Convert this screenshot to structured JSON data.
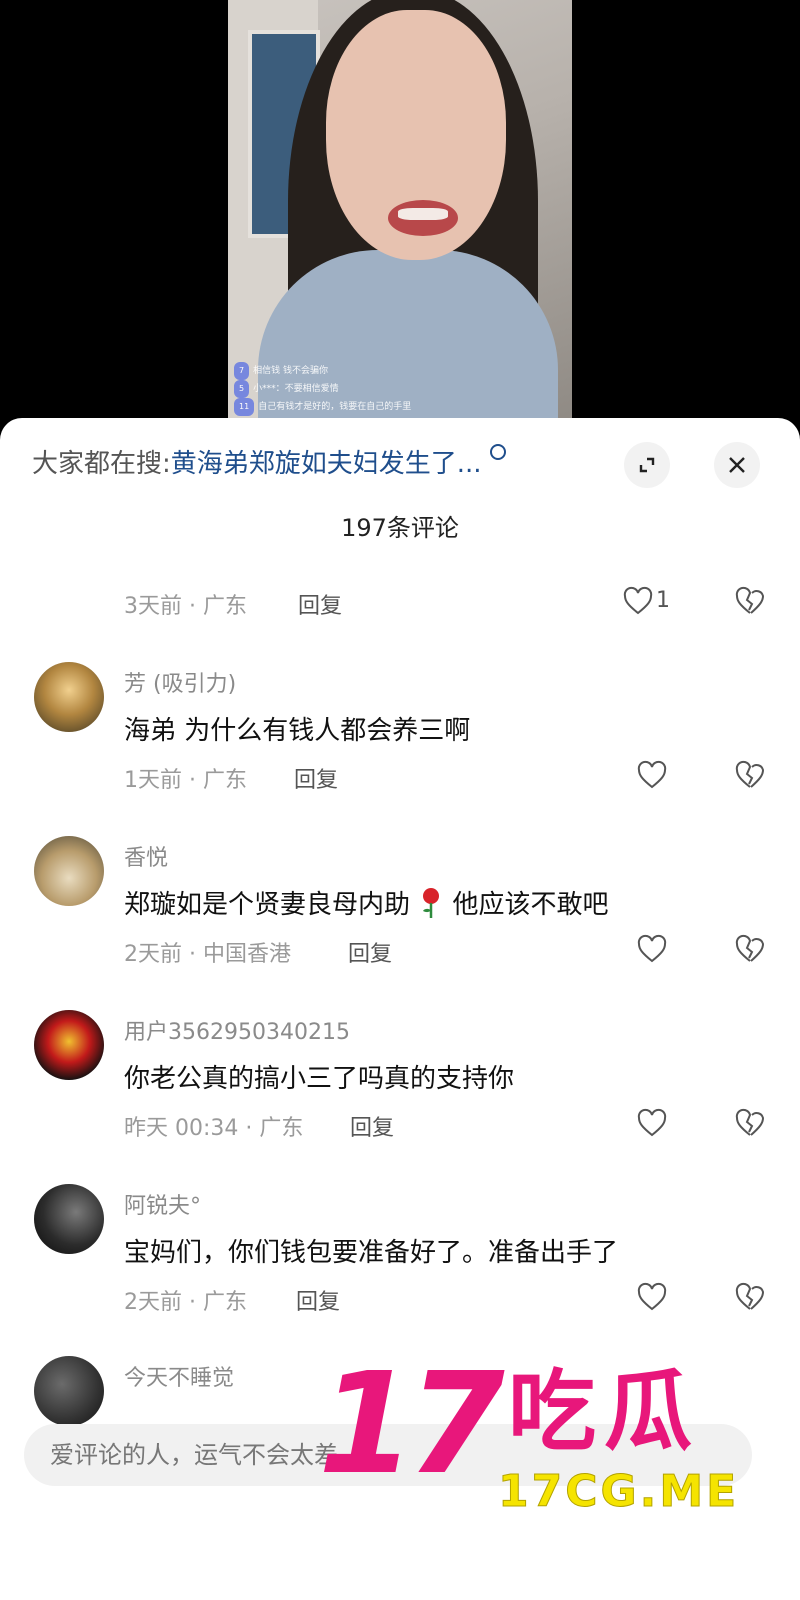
{
  "video": {
    "chat": [
      {
        "level": "7",
        "text": "相信钱 钱不会骗你"
      },
      {
        "level": "5",
        "text": "小***：不要相信爱情"
      },
      {
        "level": "11",
        "text": "自己有钱才是好的，钱要在自己的手里"
      }
    ]
  },
  "sheet": {
    "search_label": "大家都在搜:",
    "search_link": "黄海弟郑旋如夫妇发生了...",
    "comment_count": "197条评论"
  },
  "comments": [
    {
      "meta": "3天前 · 广东",
      "reply": "回复",
      "like_count": "1"
    },
    {
      "username": "芳 (吸引力)",
      "text": "海弟 为什么有钱人都会养三啊",
      "meta": "1天前 · 广东",
      "reply": "回复"
    },
    {
      "username": "香悦",
      "text_a": "郑璇如是个贤妻良母内助",
      "text_b": "他应该不敢吧",
      "meta": "2天前 · 中国香港",
      "reply": "回复"
    },
    {
      "username": "用户3562950340215",
      "text": "你老公真的搞小三了吗真的支持你",
      "meta": "昨天 00:34 · 广东",
      "reply": "回复"
    },
    {
      "username": "阿锐夫°",
      "text": "宝妈们，你们钱包要准备好了。准备出手了",
      "meta": "2天前 · 广东",
      "reply": "回复"
    },
    {
      "username": "今天不睡觉"
    }
  ],
  "input": {
    "placeholder": "爱评论的人，运气不会太差"
  },
  "watermark": {
    "big": "17",
    "cn": "吃瓜",
    "domain": "17CG.ME"
  },
  "colors": {
    "link": "#1f4e8c",
    "watermark_pink": "#e8177b",
    "watermark_yellow": "#f5e400"
  }
}
